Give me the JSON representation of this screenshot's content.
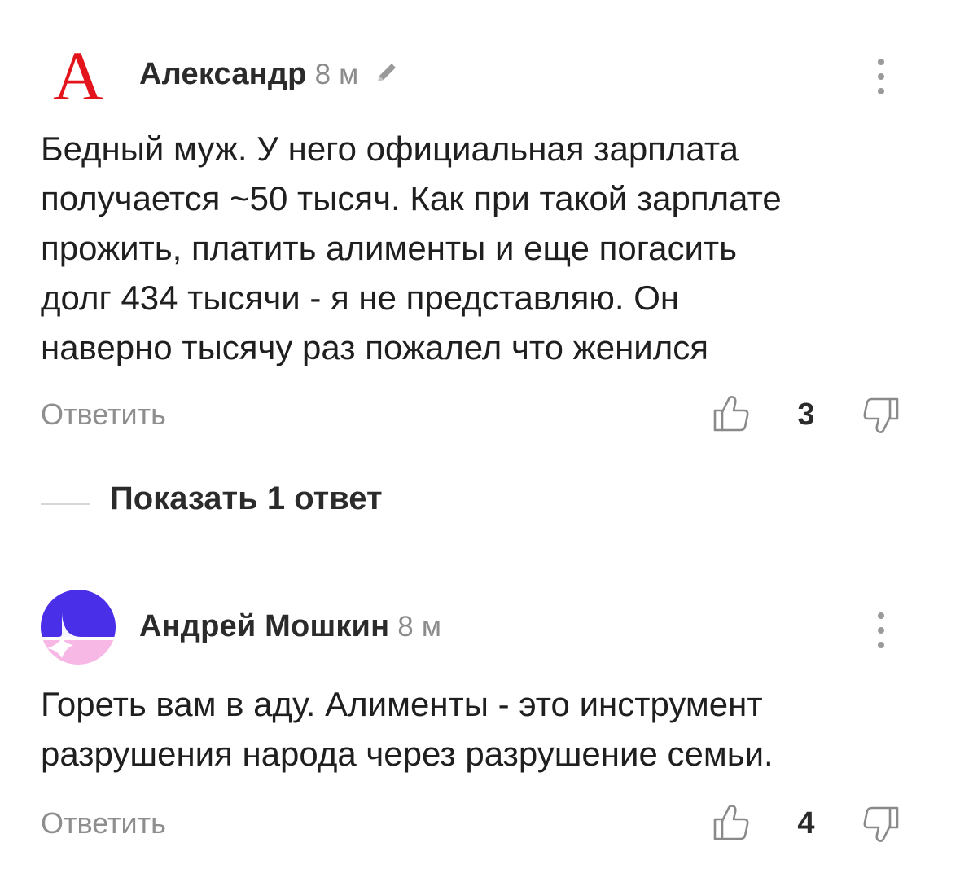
{
  "comments": [
    {
      "author": "Александр",
      "time": "8 м",
      "avatar_letter": "А",
      "text": "Бедный муж. У него официальная зарплата\nполучается ~50 тысяч. Как при такой зарплате\nпрожить, платить алименты и еще погасить\nдолг 434 тысячи - я не представляю. Он\nнаверно тысячу раз пожалел что женился",
      "reply_label": "Ответить",
      "likes": "3",
      "edited_icon": "pencil-icon"
    },
    {
      "author": "Андрей Мошкин",
      "time": "8 м",
      "text": "Гореть вам в аду. Алименты - это инструмент\nразрушения народа через разрушение семьи.",
      "reply_label": "Ответить",
      "likes": "4"
    }
  ],
  "show_replies_label": "Показать 1 ответ",
  "colors": {
    "avatar_letter": "#e3141c",
    "avatar_blue": "#4a2fe8",
    "avatar_pink": "#f8b8e6",
    "muted": "#8e8e8e",
    "text": "#1f1f1f"
  },
  "icons": [
    "pencil-icon",
    "more-vertical-icon",
    "thumbs-up-icon",
    "thumbs-down-icon"
  ]
}
